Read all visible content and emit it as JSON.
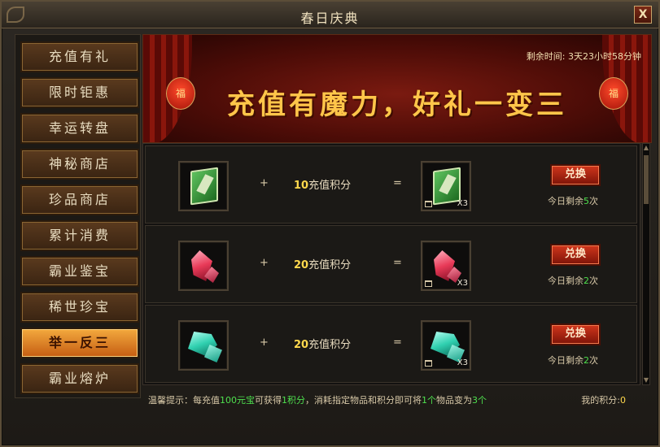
{
  "window": {
    "title": "春日庆典",
    "close_label": "X"
  },
  "sidebar": {
    "items": [
      {
        "label": "充值有礼"
      },
      {
        "label": "限时钜惠"
      },
      {
        "label": "幸运转盘"
      },
      {
        "label": "神秘商店"
      },
      {
        "label": "珍品商店"
      },
      {
        "label": "累计消费"
      },
      {
        "label": "霸业鉴宝"
      },
      {
        "label": "稀世珍宝"
      },
      {
        "label": "举一反三",
        "active": true
      },
      {
        "label": "霸业熔炉"
      }
    ]
  },
  "banner": {
    "slogan": "充值有魔力，好礼一变三",
    "countdown_label": "剩余时间:",
    "countdown_value": "3天23小时58分钟",
    "lantern_char": "福"
  },
  "rows": [
    {
      "input_item": "green-book-icon",
      "points": "10",
      "points_label": "充值积分",
      "plus": "+",
      "equals": "=",
      "output_count": "X3",
      "button": "兑换",
      "remain_prefix": "今日剩余",
      "remain_num": "5",
      "remain_suffix": "次"
    },
    {
      "input_item": "red-crystal-icon",
      "points": "20",
      "points_label": "充值积分",
      "plus": "+",
      "equals": "=",
      "output_count": "X3",
      "button": "兑换",
      "remain_prefix": "今日剩余",
      "remain_num": "2",
      "remain_suffix": "次"
    },
    {
      "input_item": "teal-crystal-icon",
      "points": "20",
      "points_label": "充值积分",
      "plus": "+",
      "equals": "=",
      "output_count": "X3",
      "button": "兑换",
      "remain_prefix": "今日剩余",
      "remain_num": "2",
      "remain_suffix": "次"
    }
  ],
  "footer": {
    "tip_prefix": "温馨提示：每充值",
    "tip_amount": "100元宝",
    "tip_mid": "可获得",
    "tip_points": "1积分",
    "tip_mid2": "，消耗指定物品和积分即可将",
    "tip_one": "1个",
    "tip_mid3": "物品变为",
    "tip_three": "3个",
    "my_points_label": "我的积分:",
    "my_points_value": "0"
  },
  "colors": {
    "accent_gold": "#ffd84d",
    "accent_green": "#4ee04e",
    "active_tab": "#f3a93e"
  }
}
